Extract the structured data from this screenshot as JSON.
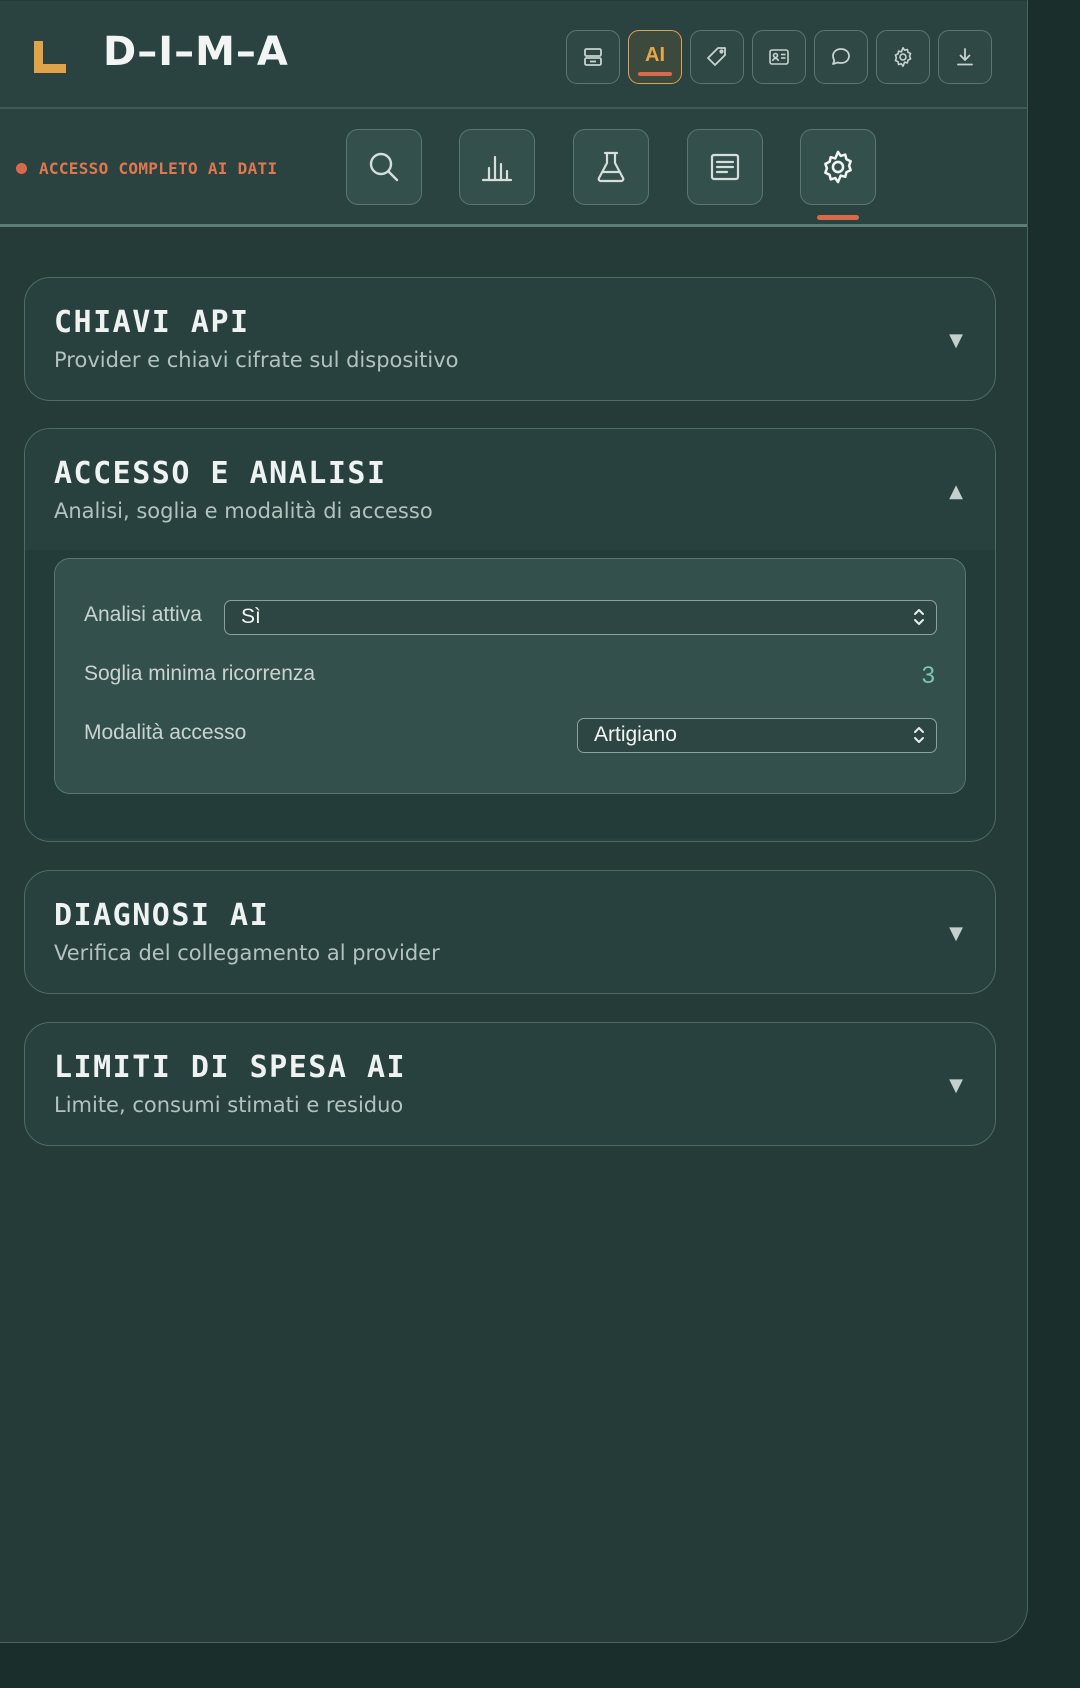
{
  "header": {
    "brand": "D–I–M–A",
    "toolbar": [
      {
        "name": "archive-icon",
        "label": ""
      },
      {
        "name": "ai-button",
        "label": "AI",
        "active": true
      },
      {
        "name": "tag-icon",
        "label": ""
      },
      {
        "name": "id-card-icon",
        "label": ""
      },
      {
        "name": "chat-icon",
        "label": ""
      },
      {
        "name": "gear-icon",
        "label": ""
      },
      {
        "name": "download-icon",
        "label": ""
      }
    ]
  },
  "status": {
    "text": "ACCESSO COMPLETO AI DATI",
    "color": "#d86a4a"
  },
  "nav": {
    "items": [
      {
        "name": "search-icon"
      },
      {
        "name": "bar-chart-icon"
      },
      {
        "name": "flask-icon"
      },
      {
        "name": "document-icon"
      },
      {
        "name": "settings-icon",
        "active": true
      }
    ]
  },
  "sections": [
    {
      "title": "CHIAVI API",
      "subtitle": "Provider e chiavi cifrate sul dispositivo",
      "arrow": "▼",
      "expanded": false
    },
    {
      "title": "ACCESSO E ANALISI",
      "subtitle": "Analisi, soglia e modalità di accesso",
      "arrow": "▲",
      "expanded": true,
      "fields": {
        "analysis_label": "Analisi attiva",
        "analysis_value": "Sì",
        "threshold_label": "Soglia minima ricorrenza",
        "threshold_value": "3",
        "mode_label": "Modalità accesso",
        "mode_value": "Artigiano"
      }
    },
    {
      "title": "DIAGNOSI AI",
      "subtitle": "Verifica del collegamento al provider",
      "arrow": "▼",
      "expanded": false
    },
    {
      "title": "LIMITI DI SPESA AI",
      "subtitle": "Limite, consumi stimati e residuo",
      "arrow": "▼",
      "expanded": false
    }
  ],
  "colors": {
    "accent_orange": "#e0a347",
    "accent_red": "#d86a4a",
    "panel": "#243b38",
    "value_teal": "#7fc3b4"
  }
}
